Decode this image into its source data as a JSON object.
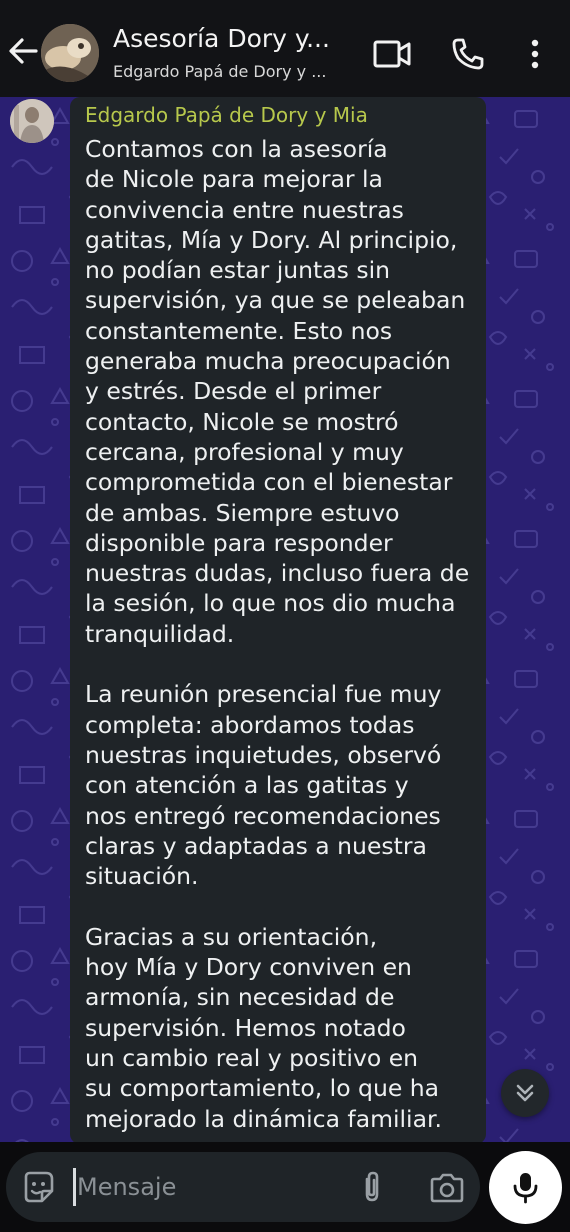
{
  "header": {
    "title": "Asesoría Dory y...",
    "subtitle": "Edgardo Papá de Dory y ..."
  },
  "message": {
    "sender": "Edgardo Papá de Dory y Mia",
    "sender_color": "#b7c84c",
    "paragraph1": [
      "Contamos con la asesoría",
      "de Nicole para mejorar la",
      "convivencia entre nuestras",
      "gatitas, Mía y Dory. Al principio,",
      "no podían estar juntas sin",
      "supervisión, ya que se peleaban",
      "constantemente. Esto nos",
      "generaba mucha preocupación",
      "y estrés. Desde el primer",
      "contacto, Nicole se mostró",
      "cercana, profesional y muy",
      "comprometida con el bienestar",
      "de ambas. Siempre estuvo",
      "disponible para responder",
      "nuestras dudas, incluso fuera de",
      "la sesión, lo que nos dio mucha",
      "tranquilidad."
    ],
    "paragraph2": [
      "La reunión presencial fue muy",
      "completa: abordamos todas",
      "nuestras inquietudes, observó",
      "con atención a las gatitas y",
      "nos entregó recomendaciones",
      "claras y adaptadas a nuestra",
      "situación."
    ],
    "paragraph3": [
      "Gracias a su orientación,",
      "hoy Mía y Dory conviven en",
      "armonía, sin necesidad de",
      "supervisión. Hemos notado",
      "un cambio real y positivo en",
      "su comportamiento, lo que ha",
      "mejorado la dinámica familiar."
    ]
  },
  "input": {
    "placeholder": "Mensaje"
  },
  "icons": {
    "back": "arrow-left-icon",
    "video": "video-call-icon",
    "call": "phone-icon",
    "more": "more-vertical-icon",
    "scroll": "double-chevron-down-icon",
    "emoji": "sticker-emoji-icon",
    "attach": "paperclip-icon",
    "camera": "camera-icon",
    "mic": "microphone-icon"
  },
  "colors": {
    "chat_background": "#2a1f72",
    "bubble": "#1f2428",
    "header": "#121316"
  }
}
